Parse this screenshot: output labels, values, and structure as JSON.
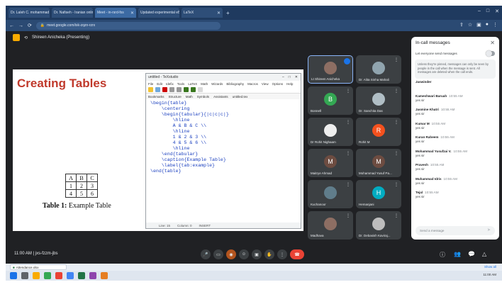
{
  "browser": {
    "tabs": [
      {
        "label": "Dr. Laleh C. mohammad ki blog",
        "active": false
      },
      {
        "label": "Dr. Nafiseh - Iranian online event",
        "active": false
      },
      {
        "label": "Meet - in-rsrd-fxs",
        "active": true
      },
      {
        "label": "Updated experimental eBook with",
        "active": false
      },
      {
        "label": "LaTeX",
        "active": false
      }
    ],
    "url": "meet.google.com/ixk-zqzn-rzrx"
  },
  "meet": {
    "header_label": "Shireen Anicheka (Presenting)",
    "clock": "11:00 AM | jxs-fzzm-jbs"
  },
  "slide": {
    "title": "Creating Tables",
    "table_rows": [
      [
        "A",
        "B",
        "C"
      ],
      [
        "1",
        "2",
        "3"
      ],
      [
        "4",
        "5",
        "6"
      ]
    ],
    "caption_prefix": "Table 1:",
    "caption_text": "Example Table"
  },
  "editor": {
    "window_title": "untitled - TeXstudio",
    "menu": [
      "File",
      "Edit",
      "Idefix",
      "Tools",
      "LaTeX",
      "Math",
      "Wizards",
      "Bibliography",
      "Macros",
      "View",
      "Options",
      "Help"
    ],
    "tabs": [
      "Bookmarks",
      "Structure",
      "Math",
      "Symbols",
      "Assistants",
      "untitled.tex"
    ],
    "code_lines": [
      "\\begin{table}",
      "    \\centering",
      "    \\begin{tabular}{|c|c|c|}",
      "        \\hline",
      "        A & B & C \\\\",
      "        \\hline",
      "        1 & 2 & 3 \\\\",
      "        4 & 5 & 6 \\\\",
      "        \\hline",
      "    \\end{tabular}",
      "    \\caption{Example Table}",
      "    \\label{tab:example}",
      "\\end{table}"
    ],
    "status": [
      "Line: 15",
      "Column: 0",
      "INSERT"
    ]
  },
  "participants": [
    {
      "name": "Lt Shireen Anicheka",
      "avatar": "photo",
      "color": "#8d6e63",
      "speaking": true
    },
    {
      "name": "Dr. Alita Sinha Mahali",
      "avatar": "photo",
      "color": "#90a4ae",
      "speaking": false
    },
    {
      "name": "Bonnell",
      "avatar": "B",
      "color": "#34a853",
      "speaking": false
    },
    {
      "name": "Dr. Sanchita Das",
      "avatar": "photo",
      "color": "#b0bec5",
      "speaking": false
    },
    {
      "name": "Dr Rohit Nighaam",
      "avatar": "photo",
      "color": "#eeeeee",
      "speaking": false
    },
    {
      "name": "Rohit M",
      "avatar": "R",
      "color": "#f4511e",
      "speaking": false
    },
    {
      "name": "Maitrye Ahmad",
      "avatar": "M",
      "color": "#6d4c41",
      "speaking": false
    },
    {
      "name": "Mohammad Yusuf Pa...",
      "avatar": "M",
      "color": "#6d4c41",
      "speaking": false
    },
    {
      "name": "Kuchanoor",
      "avatar": "photo",
      "color": "#607d8b",
      "speaking": false
    },
    {
      "name": "Hemanjani",
      "avatar": "H",
      "color": "#00acc1",
      "speaking": false
    },
    {
      "name": "Madhava",
      "avatar": "photo",
      "color": "#8d6e63",
      "speaking": false
    },
    {
      "name": "Dr. Debasish Kaviraj...",
      "avatar": "photo",
      "color": "#bdbdbd",
      "speaking": false
    }
  ],
  "chat": {
    "title": "In-call messages",
    "toggle_label": "Let everyone send messages",
    "notice": "Unless they're pinned, messages can only be seen by people in the call when the message is sent. All messages are deleted when the call ends.",
    "messages": [
      {
        "who": "Jaswinder",
        "time": "",
        "text": ""
      },
      {
        "who": "Kameshwari Baruah",
        "time": "10:55 AM",
        "text": "yes sir"
      },
      {
        "who": "Jasmine Khatri",
        "time": "10:55 AM",
        "text": "yes sir"
      },
      {
        "who": "Kumar M",
        "time": "10:55 AM",
        "text": "yes sir"
      },
      {
        "who": "Kuran Raheem",
        "time": "10:55 AM",
        "text": "yes sir"
      },
      {
        "who": "Mohammad Yusufzai V.",
        "time": "10:55 AM",
        "text": "yes sir"
      },
      {
        "who": "Pravesh",
        "time": "10:55 AM",
        "text": "yes sir"
      },
      {
        "who": "Muhammad Idris",
        "time": "10:55 AM",
        "text": "yes sir"
      },
      {
        "who": "Tejal",
        "time": "10:55 AM",
        "text": "yes sir"
      }
    ],
    "input_placeholder": "Send a message"
  },
  "downloads": {
    "item": "Attendance.xlsx",
    "show_all": "Show all"
  },
  "taskbar": {
    "clock": "11:00 AM"
  },
  "colors": {
    "accent": "#1a73e8",
    "hangup": "#ea4335",
    "slide_title": "#c0392b",
    "meet_bg": "#202124"
  }
}
